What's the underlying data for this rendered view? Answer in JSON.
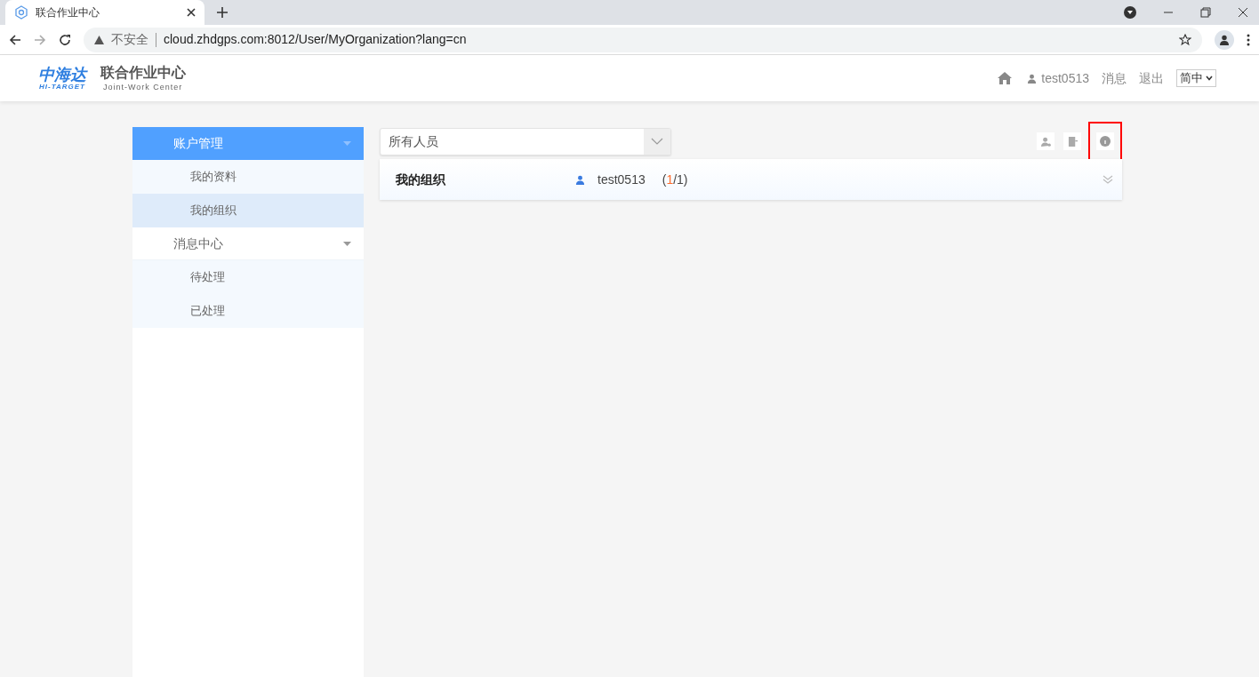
{
  "browser": {
    "tab": {
      "title": "联合作业中心"
    },
    "address": {
      "security": "不安全",
      "url": "cloud.zhdgps.com:8012/User/MyOrganization?lang=cn"
    }
  },
  "header": {
    "logo": {
      "brand": "中海达",
      "brand_en": "HI-TARGET"
    },
    "title": "联合作业中心",
    "subtitle": "Joint-Work Center",
    "user": "test0513",
    "links": [
      "消息",
      "退出"
    ],
    "language": "简中"
  },
  "sidebar": {
    "groups": [
      {
        "label": "账户管理",
        "active": true,
        "children": [
          {
            "label": "我的资料",
            "selected": false
          },
          {
            "label": "我的组织",
            "selected": true
          }
        ]
      },
      {
        "label": "消息中心",
        "active": false,
        "children": [
          {
            "label": "待处理",
            "selected": false
          },
          {
            "label": "已处理",
            "selected": false
          }
        ]
      }
    ]
  },
  "filter": {
    "value": "所有人员"
  },
  "toolbar": [
    {
      "kind": "member",
      "highlighted": false
    },
    {
      "kind": "export",
      "highlighted": false
    },
    {
      "kind": "info",
      "highlighted": true
    }
  ],
  "organization": {
    "name": "我的组织",
    "owner": "test0513",
    "count": {
      "before": "(",
      "highlight": "1",
      "after": "/1)"
    }
  }
}
